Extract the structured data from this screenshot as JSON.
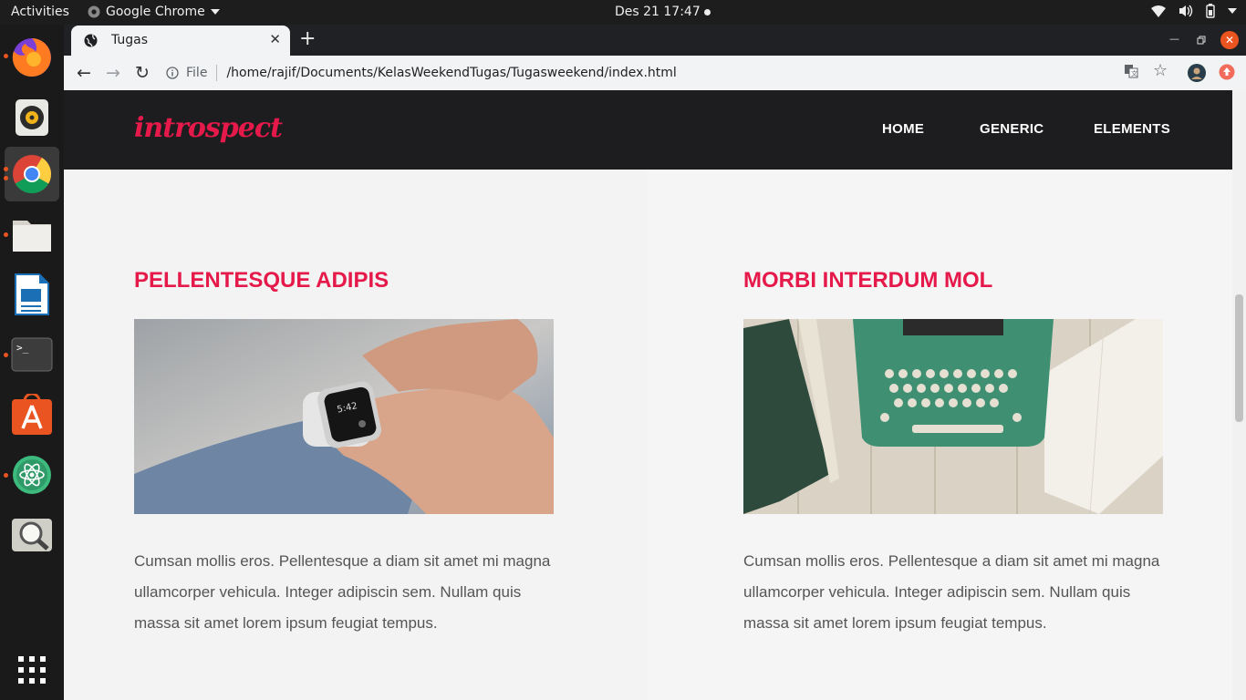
{
  "desktop": {
    "activities": "Activities",
    "app_menu": "Google Chrome",
    "clock": "Des 21  17:47"
  },
  "browser": {
    "tab_title": "Tugas",
    "new_tab": "+",
    "address_scheme": "File",
    "address_url": "/home/rajif/Documents/KelasWeekendTugas/Tugasweekend/index.html"
  },
  "site": {
    "logo": "introspect",
    "nav": [
      "HOME",
      "GENERIC",
      "ELEMENTS"
    ],
    "posts": [
      {
        "title": "PELLENTESQUE ADIPIS",
        "text": "Cumsan mollis eros. Pellentesque a diam sit amet mi magna ullamcorper vehicula. Integer adipiscin sem. Nullam quis massa sit amet lorem ipsum feugiat tempus."
      },
      {
        "title": "MORBI INTERDUM MOL",
        "text": "Cumsan mollis eros. Pellentesque a diam sit amet mi magna ullamcorper vehicula. Integer adipiscin sem. Nullam quis massa sit amet lorem ipsum feugiat tempus."
      }
    ]
  },
  "colors": {
    "accent": "#e5194a",
    "header_bg": "#1d1d1f",
    "ubuntu_orange": "#e95420"
  }
}
